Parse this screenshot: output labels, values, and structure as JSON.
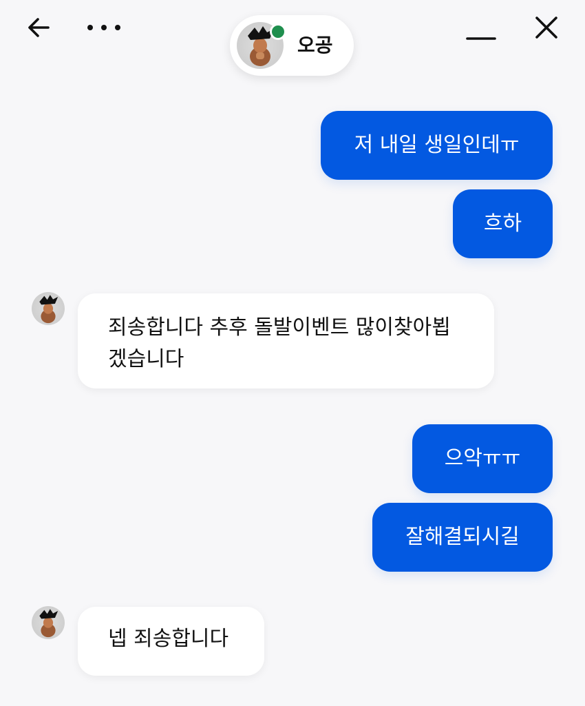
{
  "header": {
    "back_icon": "arrow-left-icon",
    "more_icon": "more-horizontal-icon",
    "minimize_icon": "minimize-icon",
    "close_icon": "close-icon",
    "profile": {
      "name": "오공",
      "status": "online",
      "status_color": "#1f8f4e"
    }
  },
  "messages": [
    {
      "sender": "me",
      "text": "저 내일 생일인데ㅠ"
    },
    {
      "sender": "me",
      "text": "흐하"
    },
    {
      "sender": "other",
      "text": "죄송합니다 추후 돌발이벤트 많이찾아뵙겠습니다"
    },
    {
      "sender": "me",
      "text": "으악ㅠㅠ"
    },
    {
      "sender": "me",
      "text": "잘해결되시길"
    },
    {
      "sender": "other",
      "text": "넵 죄송합니다"
    }
  ],
  "colors": {
    "outgoing_bubble": "#0359e1",
    "incoming_bubble": "#ffffff",
    "background": "#f7f7f9"
  }
}
